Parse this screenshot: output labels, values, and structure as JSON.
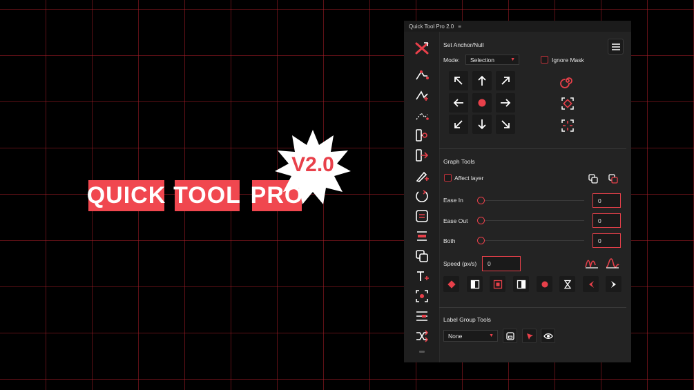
{
  "hero": {
    "words": [
      "QUICK",
      "TOOL",
      "PRO"
    ],
    "badge": "V2.0"
  },
  "panel": {
    "title": "Quick Tool Pro 2.0",
    "menu_glyph": "≡",
    "anchor": {
      "title": "Set Anchor/Null",
      "mode_label": "Mode:",
      "mode_value": "Selection",
      "ignore_mask_label": "Ignore Mask"
    },
    "graph": {
      "title": "Graph Tools",
      "affect_layer_label": "Affect layer",
      "ease_in_label": "Ease In",
      "ease_in_value": "0",
      "ease_out_label": "Ease Out",
      "ease_out_value": "0",
      "both_label": "Both",
      "both_value": "0",
      "speed_label": "Speed (px/s)",
      "speed_value": "0"
    },
    "labels": {
      "title": "Label Group Tools",
      "group_value": "None"
    },
    "toolbar_icons": [
      "close-x-icon",
      "path-tool-icon",
      "path-edit-icon",
      "path-dots-icon",
      "link-icon",
      "export-icon",
      "pen-add-icon",
      "rotate-icon",
      "text-align-icon",
      "distribute-icon",
      "duplicate-icon",
      "text-tool-icon",
      "focus-icon",
      "align-icon",
      "shuffle-icon"
    ]
  },
  "colors": {
    "accent": "#e8404a",
    "panel_bg": "#232323",
    "background": "#000000"
  }
}
